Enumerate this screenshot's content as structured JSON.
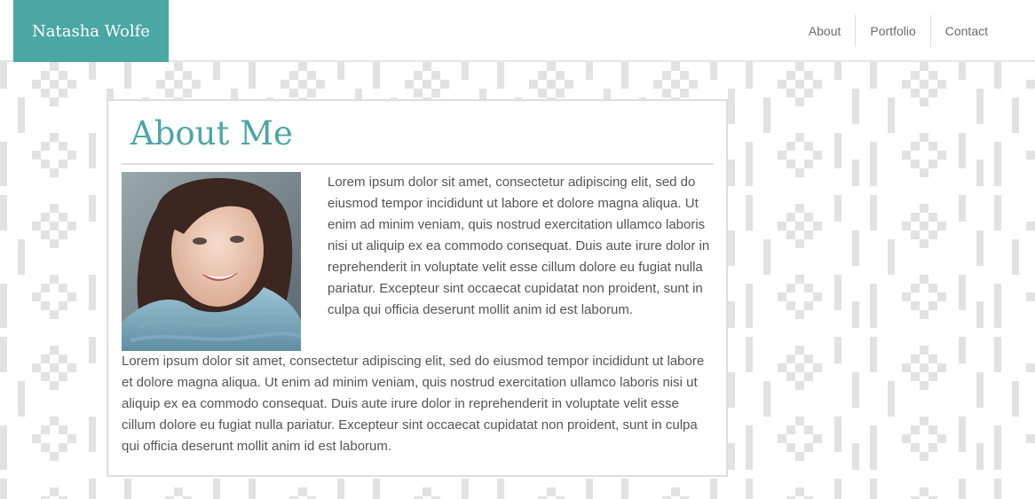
{
  "header": {
    "brand": "Natasha Wolfe",
    "nav": [
      {
        "label": "About"
      },
      {
        "label": "Portfolio"
      },
      {
        "label": "Contact"
      }
    ]
  },
  "main": {
    "title": "About Me",
    "paragraph1": "Lorem ipsum dolor sit amet, consectetur adipiscing elit, sed do eiusmod tempor incididunt ut labore et dolore magna aliqua. Ut enim ad minim veniam, quis nostrud exercitation ullamco laboris nisi ut aliquip ex ea commodo consequat. Duis aute irure dolor in reprehenderit in voluptate velit esse cillum dolore eu fugiat nulla pariatur. Excepteur sint occaecat cupidatat non proident, sunt in culpa qui officia deserunt mollit anim id est laborum.",
    "paragraph2": "Lorem ipsum dolor sit amet, consectetur adipiscing elit, sed do eiusmod tempor incididunt ut labore et dolore magna aliqua. Ut enim ad minim veniam, quis nostrud exercitation ullamco laboris nisi ut aliquip ex ea commodo consequat. Duis aute irure dolor in reprehenderit in voluptate velit esse cillum dolore eu fugiat nulla pariatur. Excepteur sint occaecat cupidatat non proident, sunt in culpa qui officia deserunt mollit anim id est laborum."
  },
  "colors": {
    "accent": "#4aa7a3",
    "pattern": "#e2e2e2",
    "text": "#555555"
  }
}
